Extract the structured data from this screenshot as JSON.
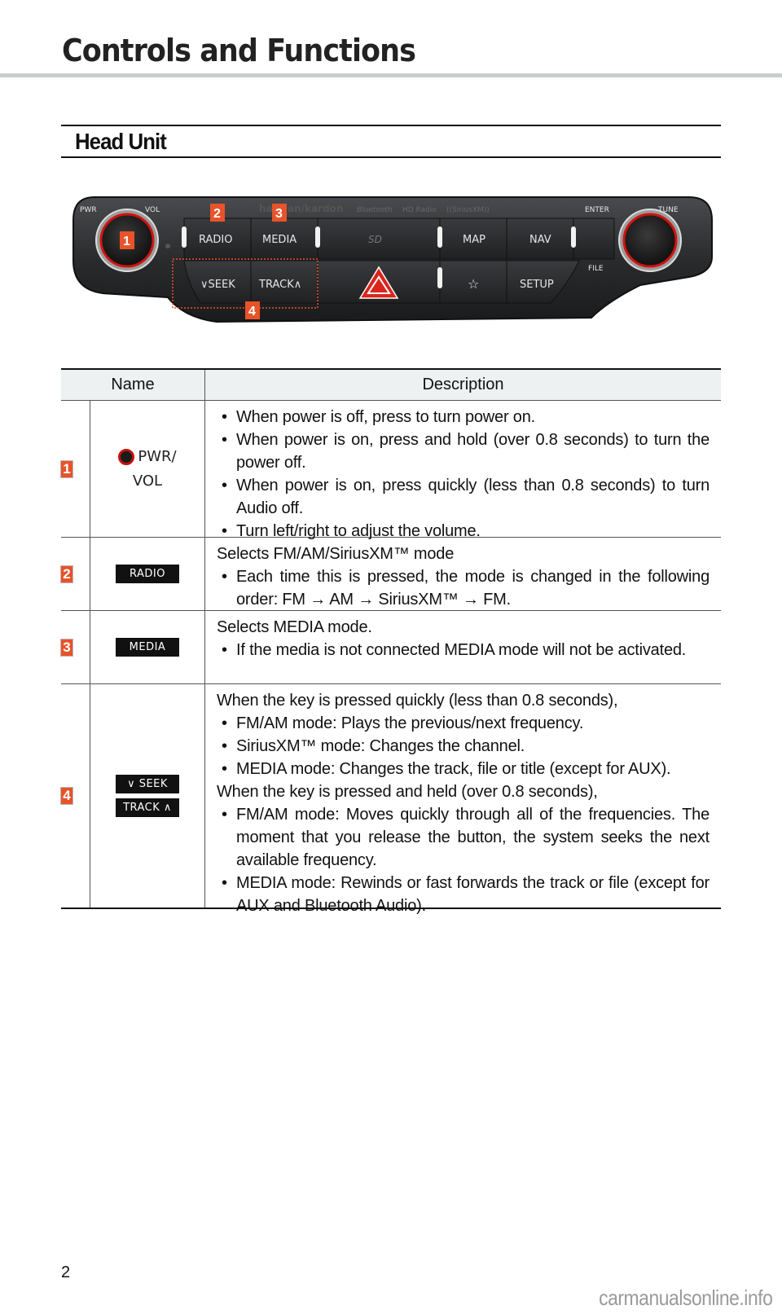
{
  "chapter": {
    "title": "Controls and Functions"
  },
  "section": {
    "title": "Head Unit"
  },
  "head_unit": {
    "brand": "harman/kardon",
    "logos": [
      "Bluetooth",
      "HD Radio",
      "SiriusXM"
    ],
    "knob_labels": {
      "left_top": "PWR",
      "left_right": "VOL",
      "right_top": "ENTER",
      "right_right": "TUNE",
      "right_bottom": "FILE"
    },
    "buttons_top": [
      "RADIO",
      "MEDIA",
      "MAP",
      "NAV"
    ],
    "sd_slot_label": "SD",
    "buttons_bottom": [
      "SEEK",
      "TRACK",
      "SETUP"
    ],
    "callouts": [
      "1",
      "2",
      "3",
      "4"
    ],
    "colors": {
      "callout": "#e8532a",
      "knob_ring": "#d0140e",
      "panel": "#2a2b2d"
    }
  },
  "table": {
    "headers": {
      "name": "Name",
      "description": "Description"
    },
    "rows": [
      {
        "number": "1",
        "name_lines": [
          "PWR/",
          "VOL"
        ],
        "keys": [],
        "intro": "",
        "bullets": [
          "When power is off, press to turn power on.",
          "When power is on, press and hold (over 0.8 seconds) to turn the power off.",
          "When power is on, press quickly (less than 0.8 seconds) to turn Audio off.",
          "Turn left/right to adjust the volume."
        ]
      },
      {
        "number": "2",
        "keys": [
          "RADIO"
        ],
        "intro": "Selects FM/AM/SiriusXM™ mode",
        "bullets": [
          "Each time this is pressed, the mode is changed in the following order: FM → AM → SiriusXM™ → FM."
        ]
      },
      {
        "number": "3",
        "keys": [
          "MEDIA"
        ],
        "intro": "Selects MEDIA mode.",
        "bullets": [
          "If the media is not connected MEDIA mode will not be activated."
        ]
      },
      {
        "number": "4",
        "keys": [
          "∨ SEEK",
          "TRACK ∧"
        ],
        "intro": "When the key is pressed quickly (less than 0.8 seconds),",
        "bullets": [
          "FM/AM mode: Plays the previous/next frequency.",
          "SiriusXM™ mode: Changes the channel.",
          "MEDIA mode: Changes the track, file or title (except for AUX)."
        ],
        "intro2": "When the key is pressed and held (over 0.8 seconds),",
        "bullets2": [
          "FM/AM mode: Moves quickly through all of the frequencies. The moment that you release the button, the system seeks the next available frequency.",
          "MEDIA mode: Rewinds or fast forwards the track or file (except for AUX and Bluetooth Audio)."
        ]
      }
    ]
  },
  "footer": {
    "page_number": "2",
    "watermark": "carmanualsonline.info"
  }
}
